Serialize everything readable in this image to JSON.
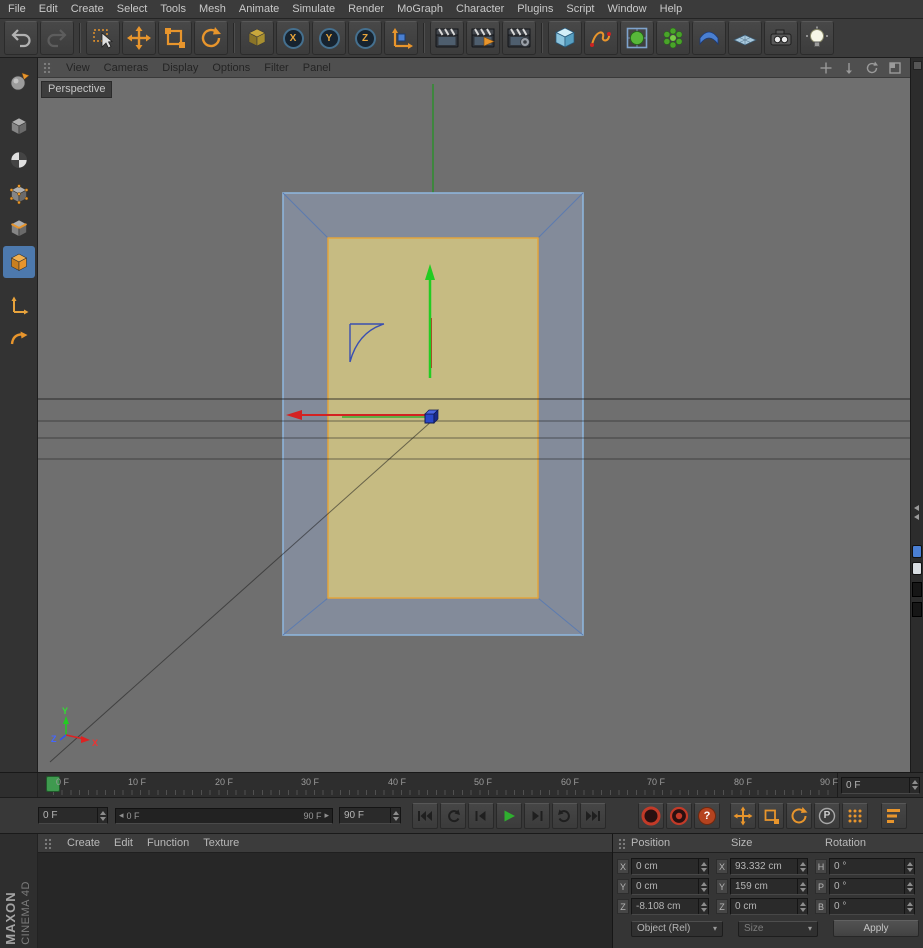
{
  "menubar": {
    "items": [
      "File",
      "Edit",
      "Create",
      "Select",
      "Tools",
      "Mesh",
      "Animate",
      "Simulate",
      "Render",
      "MoGraph",
      "Character",
      "Plugins",
      "Script",
      "Window",
      "Help"
    ]
  },
  "toolbar": {
    "lock_axes": [
      "X",
      "Y",
      "Z"
    ]
  },
  "viewport": {
    "label": "Perspective",
    "menu": [
      "View",
      "Cameras",
      "Display",
      "Options",
      "Filter",
      "Panel"
    ],
    "axis": {
      "x": "X",
      "y": "Y",
      "z": "Z"
    }
  },
  "timeline": {
    "ticks": [
      "0 F",
      "10 F",
      "20 F",
      "30 F",
      "40 F",
      "50 F",
      "60 F",
      "70 F",
      "80 F",
      "90 F"
    ],
    "frame_display": "0 F",
    "frame_field": "0 F",
    "range_start": "0 F",
    "range_end": "90 F",
    "end_field": "90 F"
  },
  "anim": {
    "parameter": "P",
    "help": "?"
  },
  "materials": {
    "menu": [
      "Create",
      "Edit",
      "Function",
      "Texture"
    ]
  },
  "coordinates": {
    "headers": [
      "Position",
      "Size",
      "Rotation"
    ],
    "rows": [
      {
        "pos_label": "X",
        "pos": "0 cm",
        "size_label": "X",
        "size": "93.332 cm",
        "rot_label": "H",
        "rot": "0 °"
      },
      {
        "pos_label": "Y",
        "pos": "0 cm",
        "size_label": "Y",
        "size": "159 cm",
        "rot_label": "P",
        "rot": "0 °"
      },
      {
        "pos_label": "Z",
        "pos": "-8.108 cm",
        "size_label": "Z",
        "size": "0 cm",
        "rot_label": "B",
        "rot": "0 °"
      }
    ],
    "mode_dropdown": "Object (Rel)",
    "size_dropdown": "Size",
    "apply": "Apply"
  },
  "branding": {
    "maxon": "MAXON",
    "cinema": "CINEMA 4D"
  },
  "icons": {
    "range_left": "◂",
    "range_right": "▸",
    "dropdown_arrow": "▾"
  },
  "colors": {
    "accent_orange": "#e8952c",
    "selection_blue": "#8fb8e0",
    "polygon_tan": "#c6bb82",
    "axis_green": "#22cc22",
    "axis_red": "#d42222",
    "axis_blue": "#2a48c8",
    "play_green": "#2fae2f",
    "record_red": "#c23a28",
    "viewport_gray": "#6f6f6f"
  }
}
